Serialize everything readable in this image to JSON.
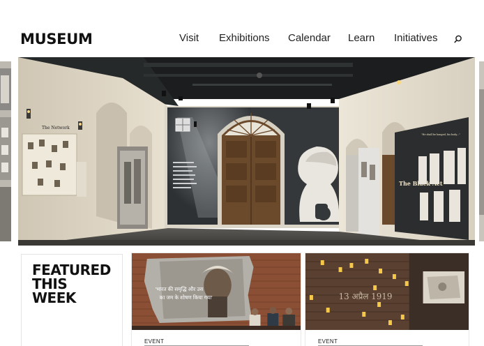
{
  "site": {
    "logo": "MUSEUM"
  },
  "nav": {
    "items": [
      {
        "label": "Visit"
      },
      {
        "label": "Exhibitions"
      },
      {
        "label": "Calendar"
      },
      {
        "label": "Learn"
      },
      {
        "label": "Initiatives"
      }
    ],
    "search_icon": "search-icon"
  },
  "hero": {
    "panel_title_1": "The Network",
    "panel_title_2": "The Black Act",
    "panel_title_3": "\"He shall be hanged, his body...\"",
    "colors": {
      "wall": "#e4dccc",
      "dark_panel": "#2e3133",
      "ceiling": "#1b1d1e",
      "floor": "#4a4845",
      "door_wood": "#6b4a2c"
    }
  },
  "featured": {
    "title": "FEATURED\nTHIS\nWEEK"
  },
  "cards": [
    {
      "tag": "EVENT",
      "screen_text_1": "'भारत की समृद्धि और उस",
      "screen_text_2": "का जम के शोषण किया गया'"
    },
    {
      "tag": "EVENT",
      "wall_text": "13 अप्रैल 1919"
    }
  ]
}
